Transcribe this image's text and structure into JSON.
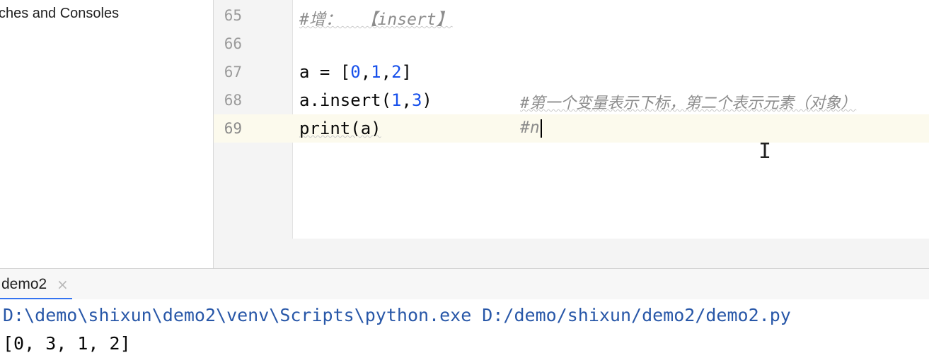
{
  "sidebar": {
    "item_label": "ches and Consoles"
  },
  "editor": {
    "lines": [
      {
        "number": "65",
        "comment": "#增：  【insert】"
      },
      {
        "number": "66"
      },
      {
        "number": "67",
        "code_prefix": "a = [",
        "n0": "0",
        "sep1": ",",
        "n1": "1",
        "sep2": ",",
        "n2": "2",
        "code_suffix": "]"
      },
      {
        "number": "68",
        "code_prefix": "a.insert(",
        "n0": "1",
        "sep1": ",",
        "n1": "3",
        "code_suffix": ")",
        "comment": "#第一个变量表示下标，第二个表示元素（对象）"
      },
      {
        "number": "69",
        "code": "print(a)",
        "comment": "#n"
      }
    ],
    "current_line": "69"
  },
  "run": {
    "tab_label": "demo2",
    "close_glyph": "×",
    "console_command": "D:\\demo\\shixun\\demo2\\venv\\Scripts\\python.exe D:/demo/shixun/demo2/demo2.py",
    "console_output": "[0, 3, 1, 2]"
  },
  "colors": {
    "number": "#1750eb",
    "comment": "#8c8c8c",
    "command": "#2857a8",
    "current_line_bg": "#fcfaed"
  }
}
